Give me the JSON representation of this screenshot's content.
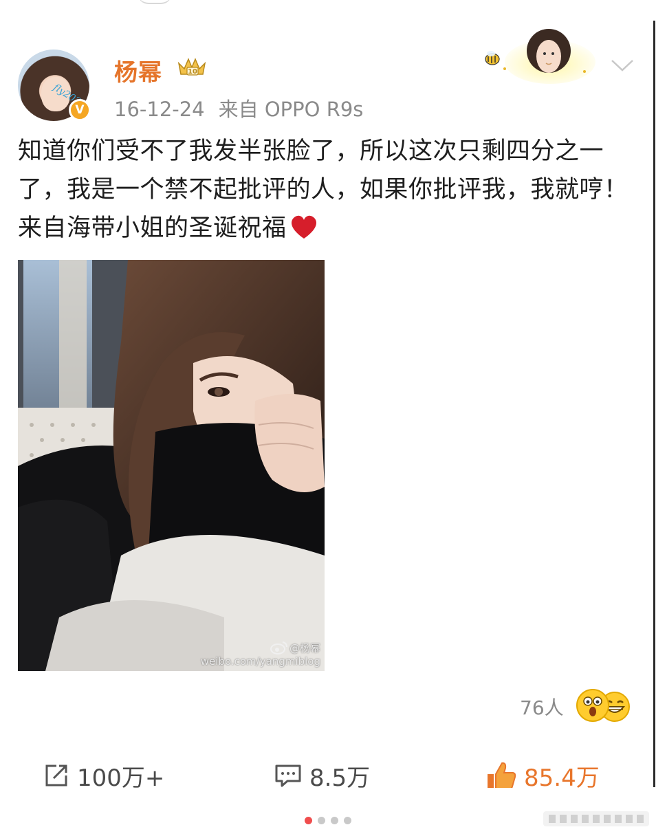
{
  "post": {
    "author": {
      "name": "杨幂",
      "avatar_ribbon": "fly2020",
      "verified_icon": "v-verified-icon",
      "badge_icon": "crown-level-badge-icon"
    },
    "meta": {
      "date": "16-12-24",
      "source": "来自 OPPO R9s"
    },
    "text": "知道你们受不了我发半张脸了，所以这次只剩四分之一了，我是一个禁不起批评的人，如果你批评我，我就哼！来自海带小姐的圣诞祝福",
    "image": {
      "watermark_handle": "@杨幂",
      "watermark_url": "weibo.com/yangmiblog"
    },
    "reactions": {
      "count": "76人",
      "icons": [
        "surprised-face-icon",
        "grinning-face-icon"
      ]
    },
    "actions": {
      "repost": "100万+",
      "comment": "8.5万",
      "like": "85.4万"
    }
  },
  "pager": {
    "total": 4,
    "active_index": 0
  },
  "colors": {
    "username": "#e5742a",
    "like": "#e8762c",
    "meta": "#8a8a8a",
    "active_dot": "#f04d4d"
  }
}
